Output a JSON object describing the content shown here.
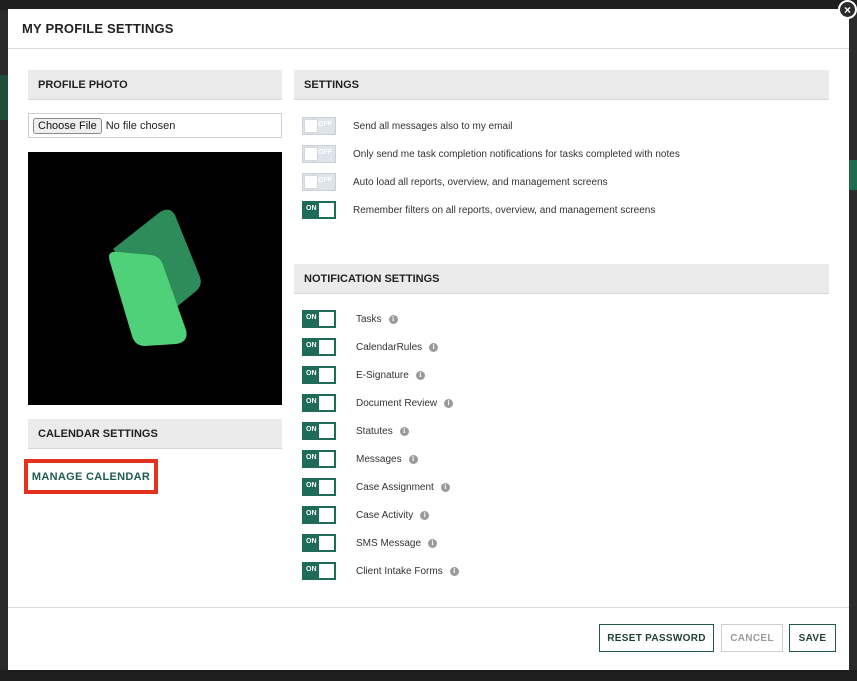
{
  "modal": {
    "title": "MY PROFILE SETTINGS",
    "close_glyph": "×"
  },
  "profile_photo": {
    "heading": "PROFILE PHOTO",
    "choose_file_label": "Choose File",
    "no_file_text": "No file chosen"
  },
  "calendar": {
    "heading": "CALENDAR SETTINGS",
    "manage_label": "MANAGE CALENDAR"
  },
  "settings": {
    "heading": "SETTINGS",
    "items": [
      {
        "label": "Send all messages also to my email",
        "state": "OFF"
      },
      {
        "label": "Only send me task completion notifications for tasks completed with notes",
        "state": "OFF"
      },
      {
        "label": "Auto load all reports, overview, and management screens",
        "state": "OFF"
      },
      {
        "label": "Remember filters on all reports, overview, and management screens",
        "state": "ON"
      }
    ]
  },
  "notifications": {
    "heading": "NOTIFICATION SETTINGS",
    "info_glyph": "i",
    "items": [
      {
        "label": "Tasks",
        "state": "ON"
      },
      {
        "label": "CalendarRules",
        "state": "ON"
      },
      {
        "label": "E-Signature",
        "state": "ON"
      },
      {
        "label": "Document Review",
        "state": "ON"
      },
      {
        "label": "Statutes",
        "state": "ON"
      },
      {
        "label": "Messages",
        "state": "ON"
      },
      {
        "label": "Case Assignment",
        "state": "ON"
      },
      {
        "label": "Case Activity",
        "state": "ON"
      },
      {
        "label": "SMS Message",
        "state": "ON"
      },
      {
        "label": "Client Intake Forms",
        "state": "ON"
      }
    ]
  },
  "footer": {
    "reset_label": "RESET PASSWORD",
    "cancel_label": "CANCEL",
    "save_label": "SAVE"
  },
  "colors": {
    "toggle_on": "#1e6b57",
    "toggle_off": "#dfe4ea",
    "highlight_border": "#e5321f",
    "logo_dark": "#2e8b5a",
    "logo_light": "#4fd17a"
  }
}
